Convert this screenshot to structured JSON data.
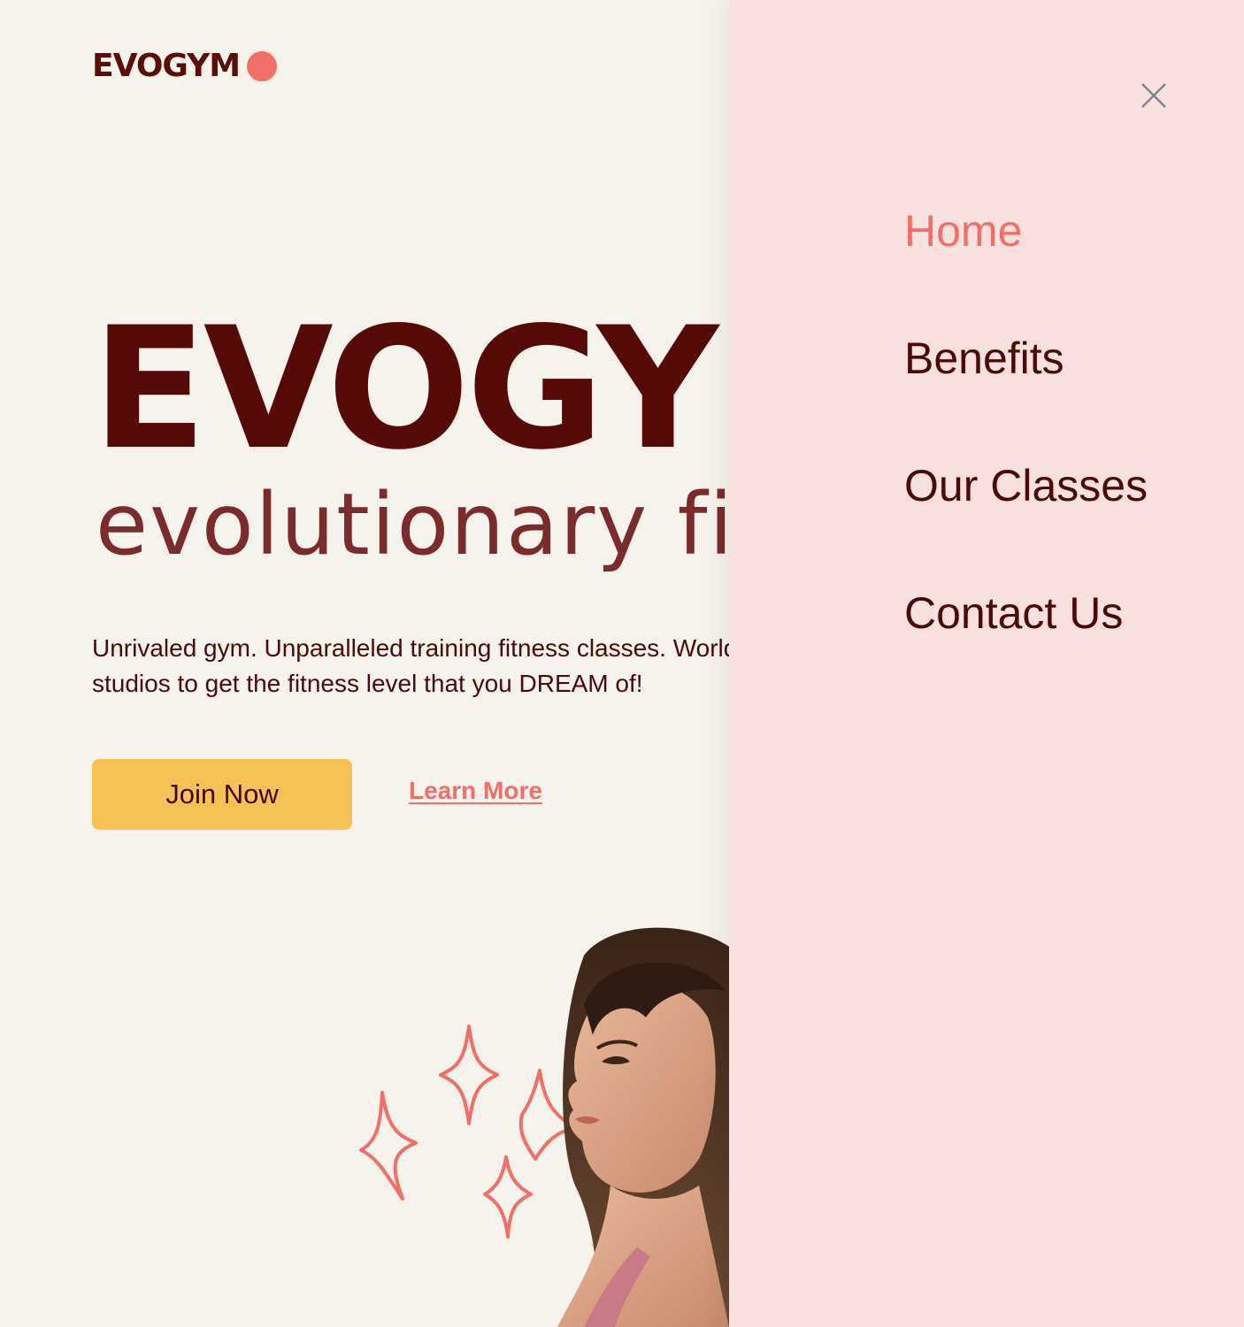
{
  "header": {
    "logo_text": "EVOGYM"
  },
  "hero": {
    "wordmark": "EVOGYM",
    "subtitle": "evolutionary fitness",
    "description": "Unrivaled gym. Unparalleled training fitness classes. World class studios to get the fitness level that you DREAM of!",
    "join_label": "Join Now",
    "learn_label": "Learn More"
  },
  "drawer": {
    "nav": [
      {
        "label": "Home",
        "active": true
      },
      {
        "label": "Benefits",
        "active": false
      },
      {
        "label": "Our Classes",
        "active": false
      },
      {
        "label": "Contact Us",
        "active": false
      }
    ]
  },
  "colors": {
    "brand_dark": "#560a07",
    "accent_coral": "#f07068",
    "button_yellow": "#f6c255",
    "drawer_bg": "#f8e0df",
    "page_bg": "#f6f3ec"
  },
  "icons": {
    "logo_dot": "circle-dot-icon",
    "close": "close-icon",
    "sparkles": "sparkle-icon"
  }
}
